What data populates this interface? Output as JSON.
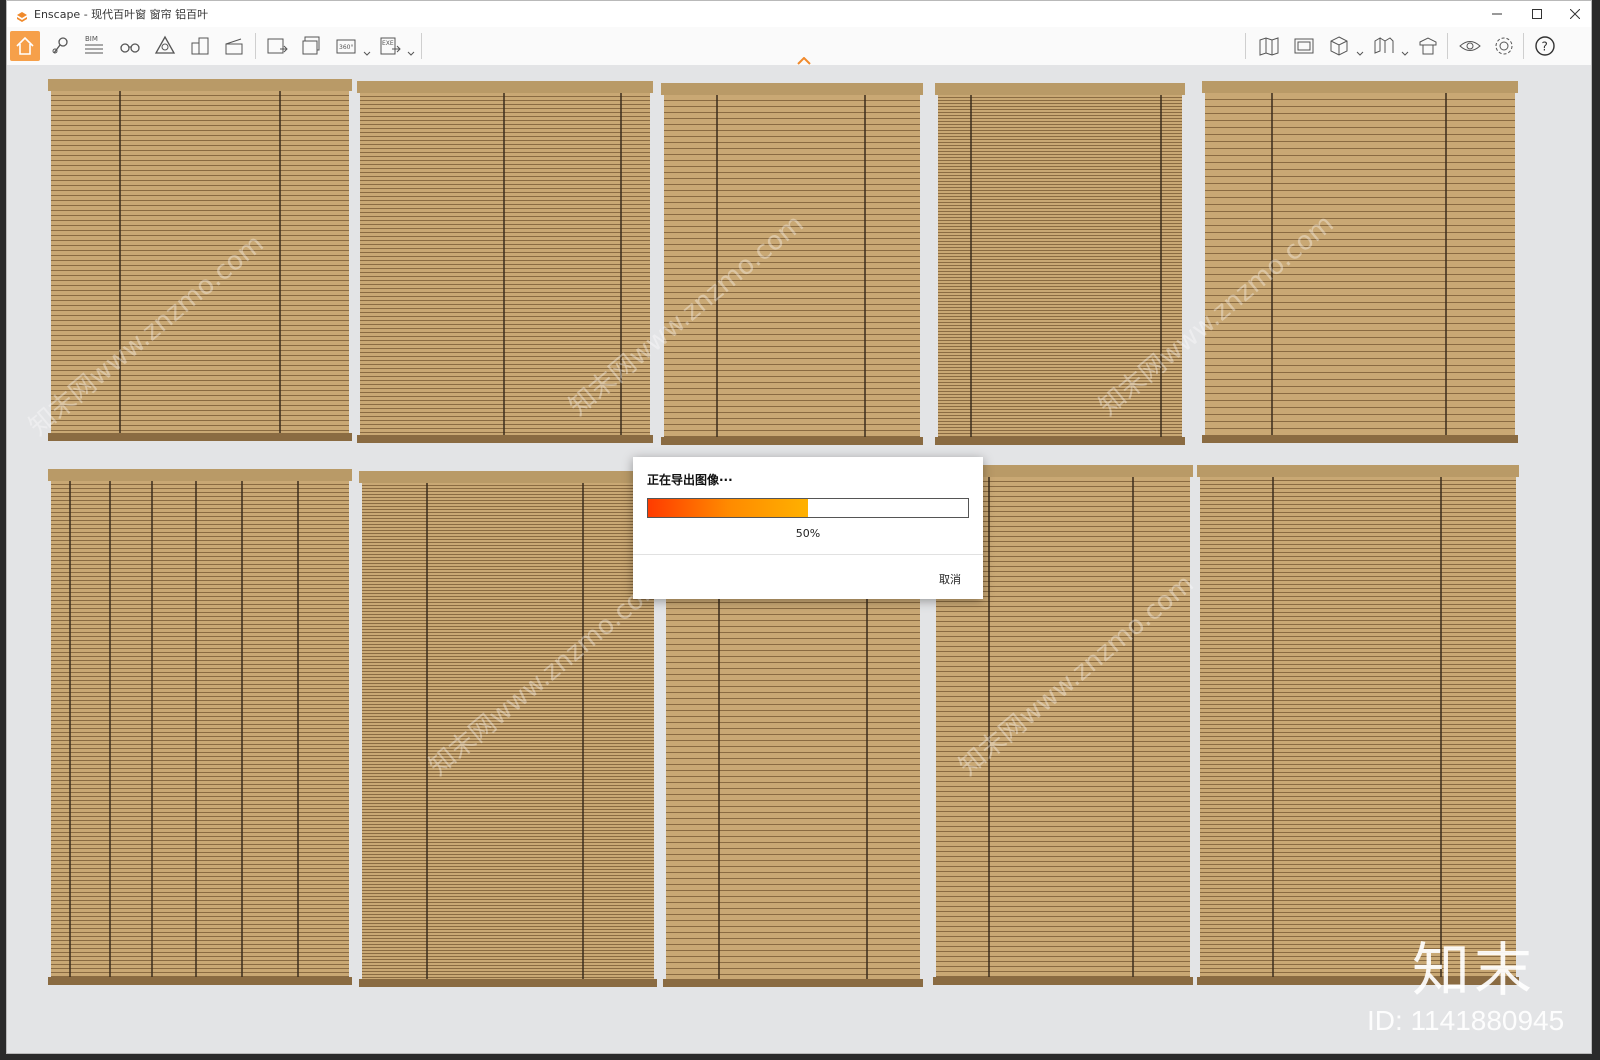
{
  "window": {
    "title": "Enscape - 现代百叶窗 窗帘 铝百叶",
    "controls": [
      "minimize",
      "maximize",
      "close"
    ]
  },
  "toolbar": {
    "bim_label": "BIM",
    "pano_label": "360°",
    "exe_label": "EXE",
    "left_icons": [
      "home-icon",
      "pin-icon",
      "bim-icon",
      "binoculars-icon",
      "perspective-icon",
      "buildings-icon",
      "clapper-icon",
      "render-image-icon",
      "batch-render-icon",
      "panorama-icon",
      "export-exe-icon"
    ],
    "right_icons": [
      "map-icon",
      "view-icon",
      "cube-icon",
      "book-icon",
      "asset-icon",
      "eye-icon",
      "settings-gear-icon",
      "help-icon"
    ]
  },
  "dialog": {
    "title": "正在导出图像···",
    "progress": 0.5,
    "progress_label": "50%",
    "cancel_label": "取消"
  },
  "watermark": {
    "logo": "知末",
    "id": "ID: 1141880945",
    "site": "知末网www.znzmo.com"
  },
  "colors": {
    "accent": "#f08a2c",
    "blind_wood": "#c9a874",
    "blind_dark": "#8a6b42",
    "viewport_bg": "#e3e4e6"
  }
}
